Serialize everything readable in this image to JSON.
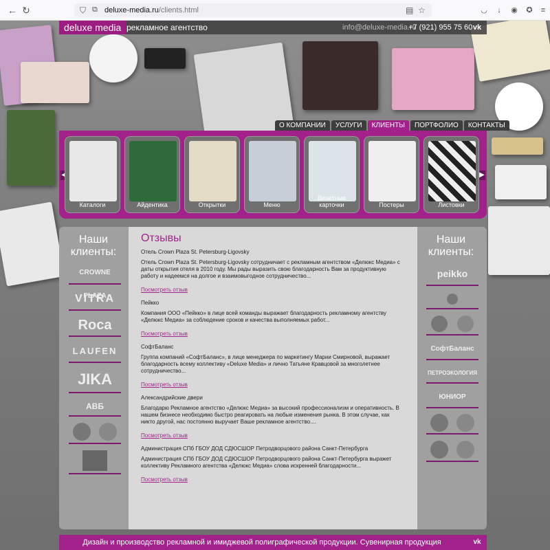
{
  "browser": {
    "url_host": "deluxe-media.ru",
    "url_path": "/clients.html"
  },
  "header": {
    "logo": "deluxe media",
    "tagline": "рекламное агентство",
    "email": "info@deluxe-media.ru",
    "phone": "+7 (921) 955 75 60"
  },
  "nav": [
    "О КОМПАНИИ",
    "УСЛУГИ",
    "КЛИЕНТЫ",
    "ПОРТФОЛИО",
    "КОНТАКТЫ"
  ],
  "nav_active": "КЛИЕНТЫ",
  "carousel": [
    "Каталоги",
    "Айдентика",
    "Открытки",
    "Меню",
    "Визитные карточки",
    "Постеры",
    "Листовки"
  ],
  "clients_title": "Наши клиенты:",
  "left_clients": [
    "CROWNE PLAZA",
    "VITRA",
    "Roca",
    "LAUFEN",
    "JIKA",
    "АВБ"
  ],
  "right_clients": [
    "peikko",
    "СофтБаланс",
    "ПЕТРОЭКОЛОГИЯ",
    "ЮНИОР"
  ],
  "reviews_title": "Отзывы",
  "reviews": [
    {
      "head": "Отель Crown Plaza St. Petersburg-Ligovsky",
      "body": "Отель Crown Plaza St. Petersburg-Ligovsky сотрудничает с рекламным агентством «Делюкс Медиа» с даты открытия отеля в 2010 году. Мы рады выразить свою благодарность Вам за продуктивную работу и надеемся на долгое и взаимовыгодное сотрудничество...",
      "link": "Посмотреть отзыв"
    },
    {
      "head": "Пейкко",
      "body": "Компания ООО «Пейкко» в лице всей команды выражает благодарность рекламному агентству «Делюкс Медиа» за соблюдение сроков и качества выполняемых работ...",
      "link": "Посмотреть отзыв"
    },
    {
      "head": "СофтБаланс",
      "body": "Группа компаний «СофтБаланс», в лице менеджера по маркетингу Марии Смирновой, выражает благодарность всему коллективу «Deluxe Media» и лично Татьяне Кравцовой за многолетнее сотрудничество...",
      "link": "Посмотреть отзыв"
    },
    {
      "head": "Александрийские двери",
      "body": "Благодарю Рекламное агентство «Делюкс Медиа» за высокий профессионализм и оперативность. В нашем бизнесе необходимо быстро реагировать на любые изменения рынка. В этом случае, как никто другой, нас постоянно выручает Ваше рекламное агентство....",
      "link": "Посмотреть отзыв"
    },
    {
      "head": "Администрация СПб ГБОУ ДОД СДЮСШОР Петродворцового района Санкт-Петербурга",
      "body": "Администрация СПб ГБОУ ДОД СДЮСШОР Петродворцового района Санкт-Петербурга выражет коллективу Рекламного агентства «Делюкс Медиа» слова искренней благодарности...",
      "link": "Посмотреть отзыв"
    }
  ],
  "footer": "Дизайн и производство рекламной и имиджевой полиграфической продукции. Сувенирная продукция",
  "colors": {
    "accent": "#a2218a",
    "dark": "#3d3d3d"
  }
}
